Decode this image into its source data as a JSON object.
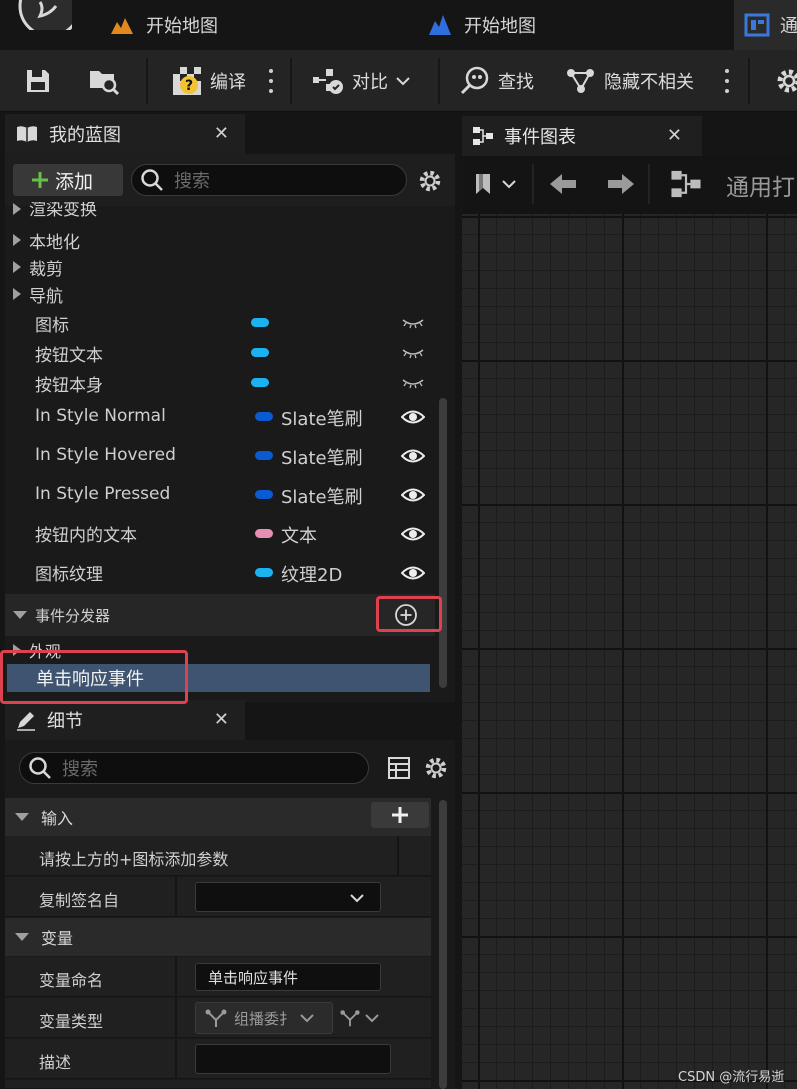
{
  "window": {
    "tabs": [
      {
        "label": "开始地图",
        "icon": "level-icon"
      },
      {
        "label": "开始地图",
        "icon": "level-blueprint-icon"
      },
      {
        "label": "通",
        "icon": "widget-blueprint-icon"
      }
    ]
  },
  "toolbar": {
    "compile_label": "编译",
    "diff_label": "对比",
    "find_label": "查找",
    "hide_label": "隐藏不相关"
  },
  "my_blueprint": {
    "title": "我的蓝图",
    "add_label": "添加",
    "search_placeholder": "搜索",
    "categories": [
      "渲染变换",
      "本地化",
      "裁剪",
      "导航"
    ],
    "variables": [
      {
        "name": "图标",
        "type": "",
        "color": "#1ab3f0",
        "visible": false
      },
      {
        "name": "按钮文本",
        "type": "",
        "color": "#1ab3f0",
        "visible": false
      },
      {
        "name": "按钮本身",
        "type": "",
        "color": "#1ab3f0",
        "visible": false
      },
      {
        "name": "In Style Normal",
        "type": "Slate笔刷",
        "color": "#0a5bd1",
        "visible": true
      },
      {
        "name": "In Style Hovered",
        "type": "Slate笔刷",
        "color": "#0a5bd1",
        "visible": true
      },
      {
        "name": "In Style Pressed",
        "type": "Slate笔刷",
        "color": "#0a5bd1",
        "visible": true
      },
      {
        "name": "按钮内的文本",
        "type": "文本",
        "color": "#e58fb3",
        "visible": true
      },
      {
        "name": "图标纹理",
        "type": "纹理2D",
        "color": "#1ab3f0",
        "visible": true
      }
    ],
    "dispatchers_label": "事件分发器",
    "appearance_label": "外观",
    "selected_dispatcher": "单击响应事件"
  },
  "details": {
    "title": "细节",
    "search_placeholder": "搜索",
    "input_section": "输入",
    "input_hint": "请按上方的+图标添加参数",
    "copy_signature_label": "复制签名自",
    "copy_signature_value": "",
    "variable_section": "变量",
    "var_name_label": "变量命名",
    "var_name_value": "单击响应事件",
    "var_type_label": "变量类型",
    "var_type_value": "组播委扌",
    "description_label": "描述",
    "description_value": ""
  },
  "graph": {
    "tab_label": "事件图表",
    "breadcrumb": "通用打"
  },
  "watermark": "CSDN @流行易逝",
  "colors": {
    "highlight": "#e0414f",
    "selected_row": "#3f5471",
    "accent_green": "#68c144"
  }
}
